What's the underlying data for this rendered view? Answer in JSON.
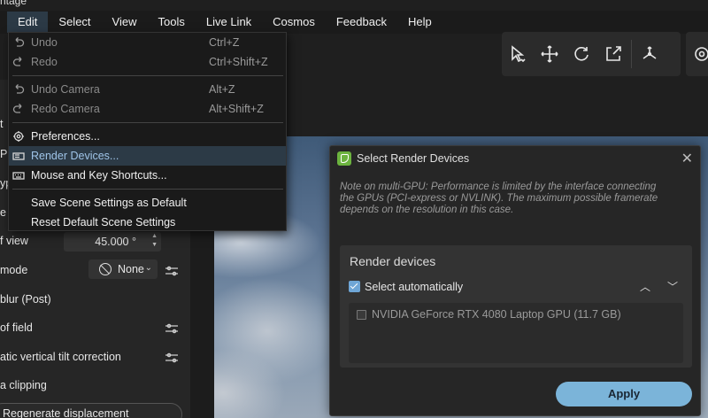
{
  "app": {
    "title_fragment": "ntage"
  },
  "menubar": [
    "Edit",
    "Select",
    "View",
    "Tools",
    "Live Link",
    "Cosmos",
    "Feedback",
    "Help"
  ],
  "toolbar": {
    "icons": [
      "select-arrow-icon",
      "move-icon",
      "rotate-icon",
      "scale-icon",
      "pivot-icon",
      "settings-icon"
    ]
  },
  "edit_menu": {
    "undo": {
      "label": "Undo",
      "shortcut": "Ctrl+Z"
    },
    "redo": {
      "label": "Redo",
      "shortcut": "Ctrl+Shift+Z"
    },
    "undo_camera": {
      "label": "Undo Camera",
      "shortcut": "Alt+Z"
    },
    "redo_camera": {
      "label": "Redo Camera",
      "shortcut": "Alt+Shift+Z"
    },
    "preferences": {
      "label": "Preferences..."
    },
    "render_devices": {
      "label": "Render Devices..."
    },
    "mouse_keys": {
      "label": "Mouse and Key Shortcuts..."
    },
    "save_scene": {
      "label": "Save Scene Settings as Default"
    },
    "reset_scene": {
      "label": "Reset Default Scene Settings"
    }
  },
  "left_panel": {
    "frag_a": "t",
    "frag_b": "P",
    "frag_c": "yp",
    "frag_d": "e",
    "field_of_view": {
      "label": "f view",
      "value": "45.000 °"
    },
    "mode": {
      "label": "mode",
      "value": "None"
    },
    "motion_blur": "blur (Post)",
    "depth_of_field": "of field",
    "tilt": "atic vertical tilt correction",
    "clipping": "a clipping",
    "regen_button": "Regenerate displacement"
  },
  "dialog": {
    "title": "Select Render Devices",
    "note": "Note on multi-GPU: Performance is limited by the interface connecting the GPUs (PCI-express or NVLINK). The maximum possible framerate depends on the resolution in this case.",
    "section_title": "Render devices",
    "select_auto": {
      "label": "Select automatically",
      "checked": true
    },
    "devices": [
      {
        "name": "NVIDIA GeForce RTX 4080 Laptop GPU (11.7 GB)",
        "checked": false
      }
    ],
    "apply_label": "Apply"
  },
  "colors": {
    "highlight": "#2c3a46",
    "accent": "#7bb4d9",
    "check": "#6fa6d6"
  }
}
